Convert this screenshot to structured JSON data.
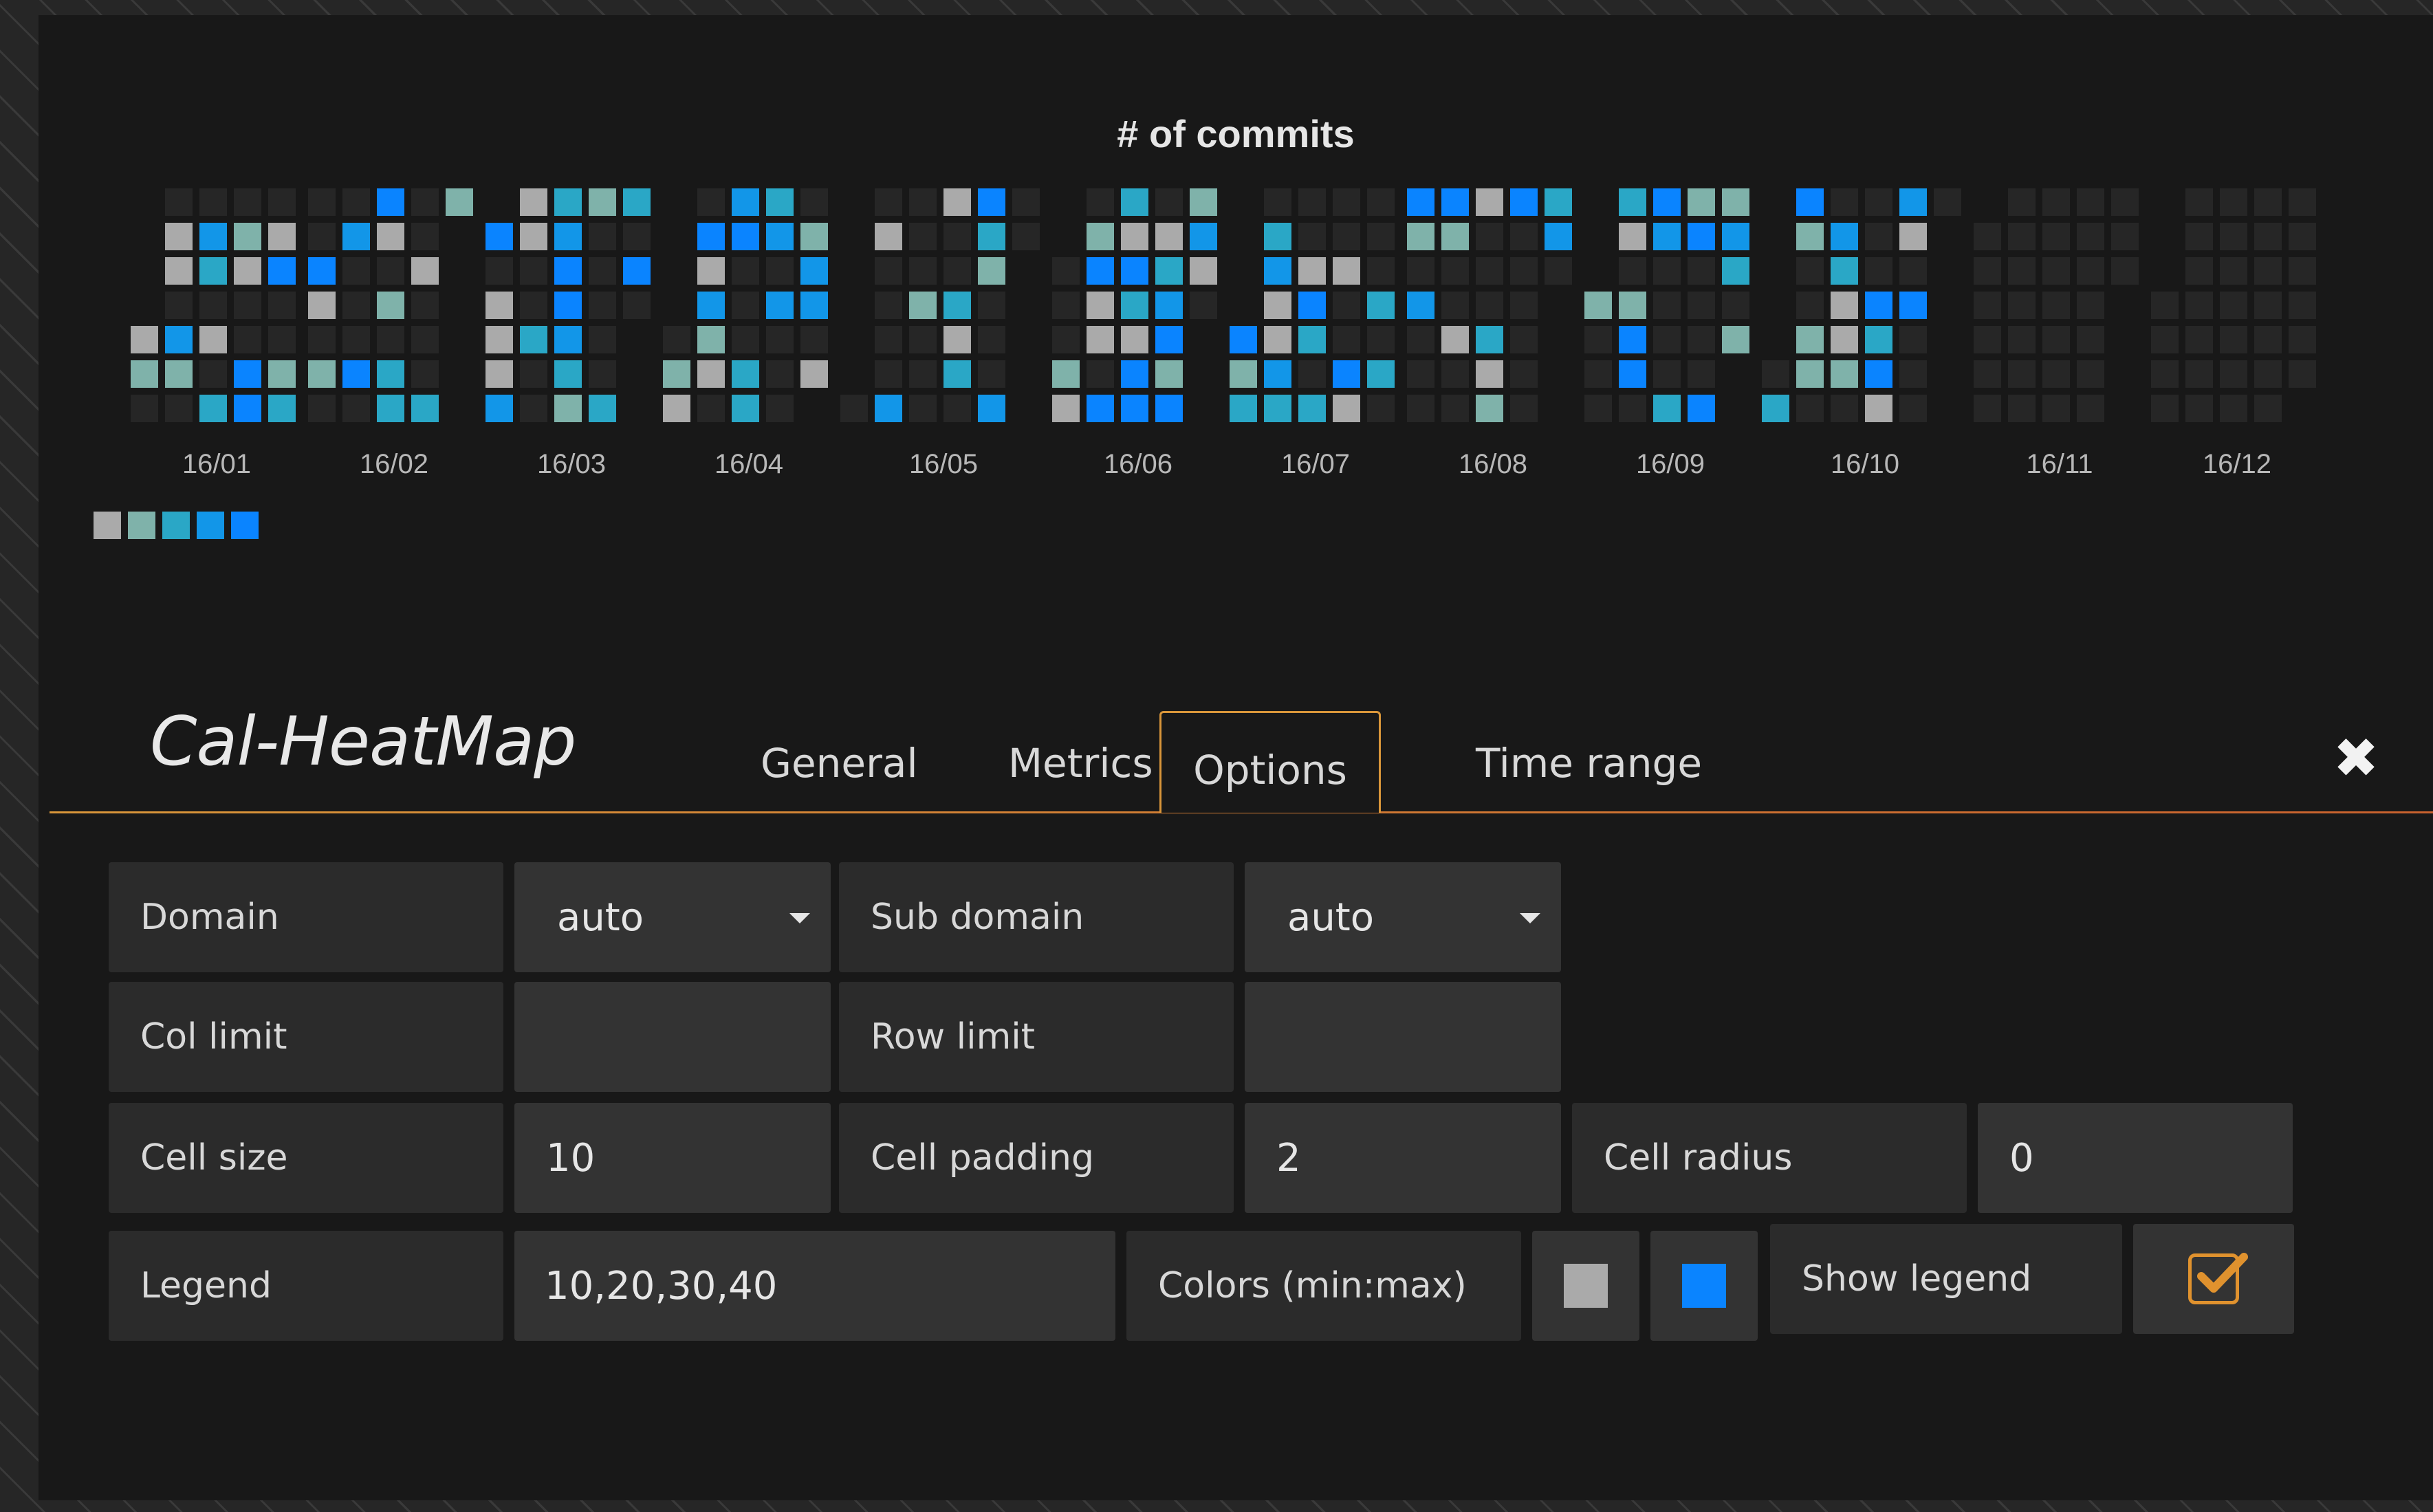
{
  "chart_data": {
    "type": "heatmap",
    "title": "# of commits",
    "months": [
      "16/01",
      "16/02",
      "16/03",
      "16/04",
      "16/05",
      "16/06",
      "16/07",
      "16/08",
      "16/09",
      "16/10",
      "16/11",
      "16/12"
    ],
    "legend_values": [
      10,
      20,
      30,
      40
    ],
    "colors": {
      "min": "#aaaaaa",
      "max": "#0a84ff",
      "empty": "#262626",
      "scale": [
        "#aaaaaa",
        "#7fb2aa",
        "#2aa7c6",
        "#1296e8",
        "#0a84ff"
      ]
    }
  },
  "editor": {
    "title": "Cal-HeatMap",
    "tabs": [
      "General",
      "Metrics",
      "Options",
      "Time range"
    ],
    "active_tab": "Options",
    "close_icon": "close-icon"
  },
  "options": {
    "domain_label": "Domain",
    "domain_value": "auto",
    "subdomain_label": "Sub domain",
    "subdomain_value": "auto",
    "col_limit_label": "Col limit",
    "col_limit_value": "",
    "row_limit_label": "Row limit",
    "row_limit_value": "",
    "cell_size_label": "Cell size",
    "cell_size_value": "10",
    "cell_padding_label": "Cell padding",
    "cell_padding_value": "2",
    "cell_radius_label": "Cell radius",
    "cell_radius_value": "0",
    "legend_label": "Legend",
    "legend_value": "10,20,30,40",
    "colors_label": "Colors (min:max)",
    "color_min": "#aaaaaa",
    "color_max": "#0a84ff",
    "show_legend_label": "Show legend",
    "show_legend": true
  }
}
